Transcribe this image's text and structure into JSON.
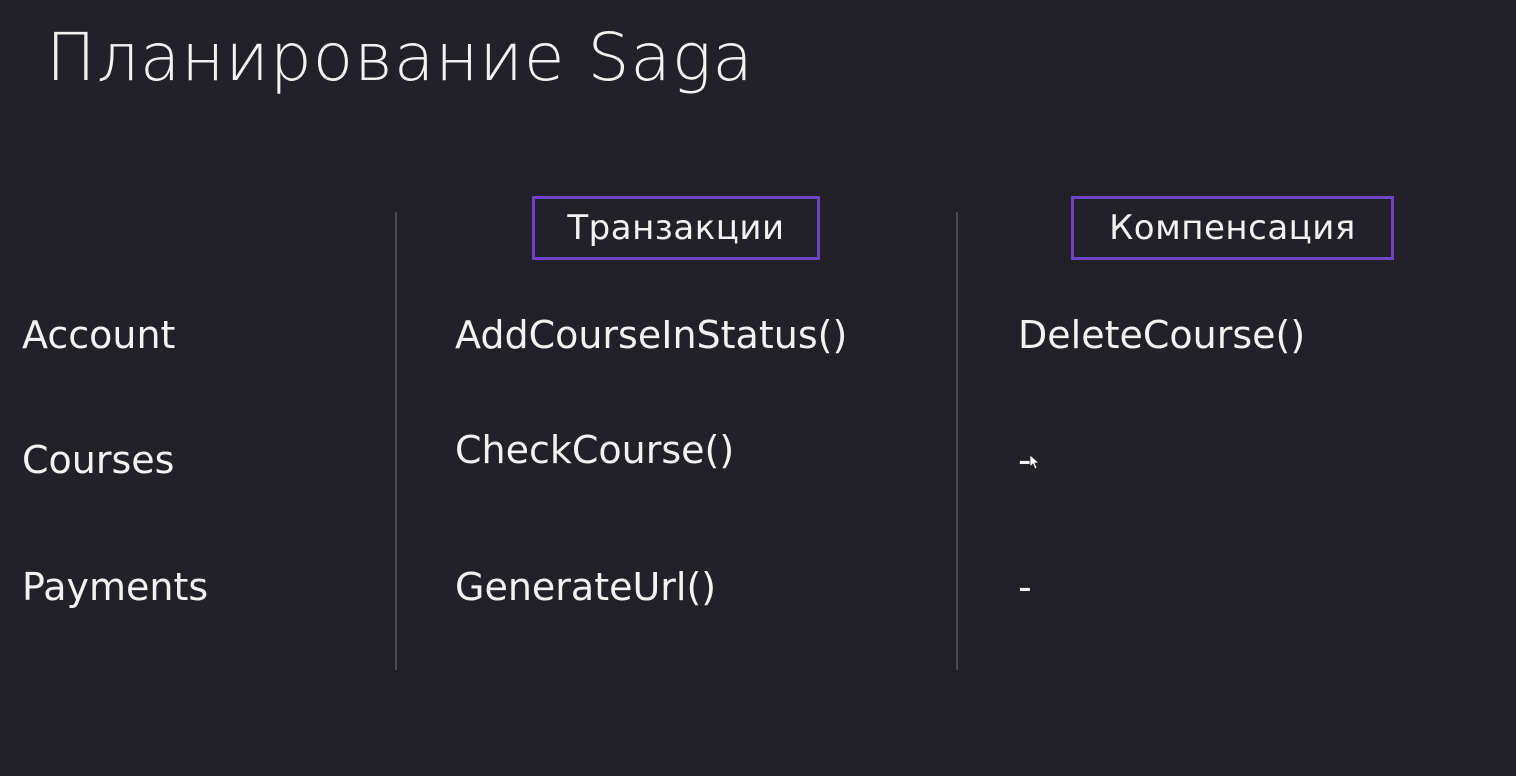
{
  "title": "Планирование Saga",
  "headers": {
    "transactions": "Транзакции",
    "compensation": "Компенсация"
  },
  "rows": [
    {
      "service": "Account",
      "transaction": "AddCourseInStatus()",
      "compensation": "DeleteCourse()"
    },
    {
      "service": "Courses",
      "transaction": "CheckCourse()",
      "compensation": "-"
    },
    {
      "service": "Payments",
      "transaction": "GenerateUrl()",
      "compensation": "-"
    }
  ],
  "colors": {
    "background": "#232128",
    "accent_border": "#6b44c8",
    "text": "#f2f2f2"
  }
}
